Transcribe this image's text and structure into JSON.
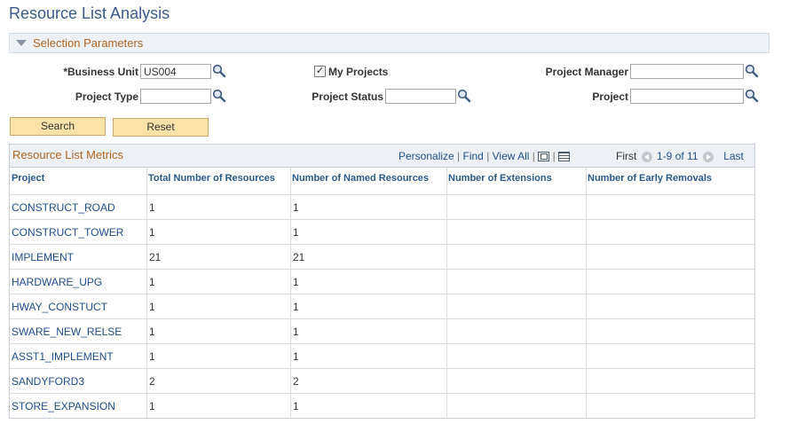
{
  "page": {
    "title": "Resource List Analysis"
  },
  "selection": {
    "label": "Selection Parameters"
  },
  "fields": {
    "business_unit": {
      "label": "*Business Unit",
      "value": "US004"
    },
    "my_projects": {
      "label": "My Projects",
      "checked": true
    },
    "project_manager": {
      "label": "Project Manager",
      "value": ""
    },
    "project_type": {
      "label": "Project Type",
      "value": ""
    },
    "project_status": {
      "label": "Project Status",
      "value": ""
    },
    "project": {
      "label": "Project",
      "value": ""
    }
  },
  "buttons": {
    "search": "Search",
    "reset": "Reset"
  },
  "grid": {
    "title": "Resource List Metrics",
    "personalize": "Personalize",
    "find": "Find",
    "view_all": "View All",
    "first": "First",
    "range": "1-9 of 11",
    "last": "Last",
    "columns": [
      "Project",
      "Total Number of Resources",
      "Number of Named Resources",
      "Number of Extensions",
      "Number of Early Removals"
    ],
    "rows": [
      [
        "CONSTRUCT_ROAD",
        "1",
        "1",
        "",
        ""
      ],
      [
        "CONSTRUCT_TOWER",
        "1",
        "1",
        "",
        ""
      ],
      [
        "IMPLEMENT",
        "21",
        "21",
        "",
        ""
      ],
      [
        "HARDWARE_UPG",
        "1",
        "1",
        "",
        ""
      ],
      [
        "HWAY_CONSTUCT",
        "1",
        "1",
        "",
        ""
      ],
      [
        "SWARE_NEW_RELSE",
        "1",
        "1",
        "",
        ""
      ],
      [
        "ASST1_IMPLEMENT",
        "1",
        "1",
        "",
        ""
      ],
      [
        "SANDYFORD3",
        "2",
        "2",
        "",
        ""
      ],
      [
        "STORE_EXPANSION",
        "1",
        "1",
        "",
        ""
      ]
    ]
  },
  "icons": {
    "lookup": "magnifier-icon",
    "collapse": "triangle-down-icon",
    "zoom": "zoom-icon",
    "download": "spreadsheet-icon"
  },
  "colors": {
    "title": "#3a5a8c",
    "section_label": "#b0651e",
    "link": "#1f4e8c",
    "button": "#fbe2a8"
  }
}
